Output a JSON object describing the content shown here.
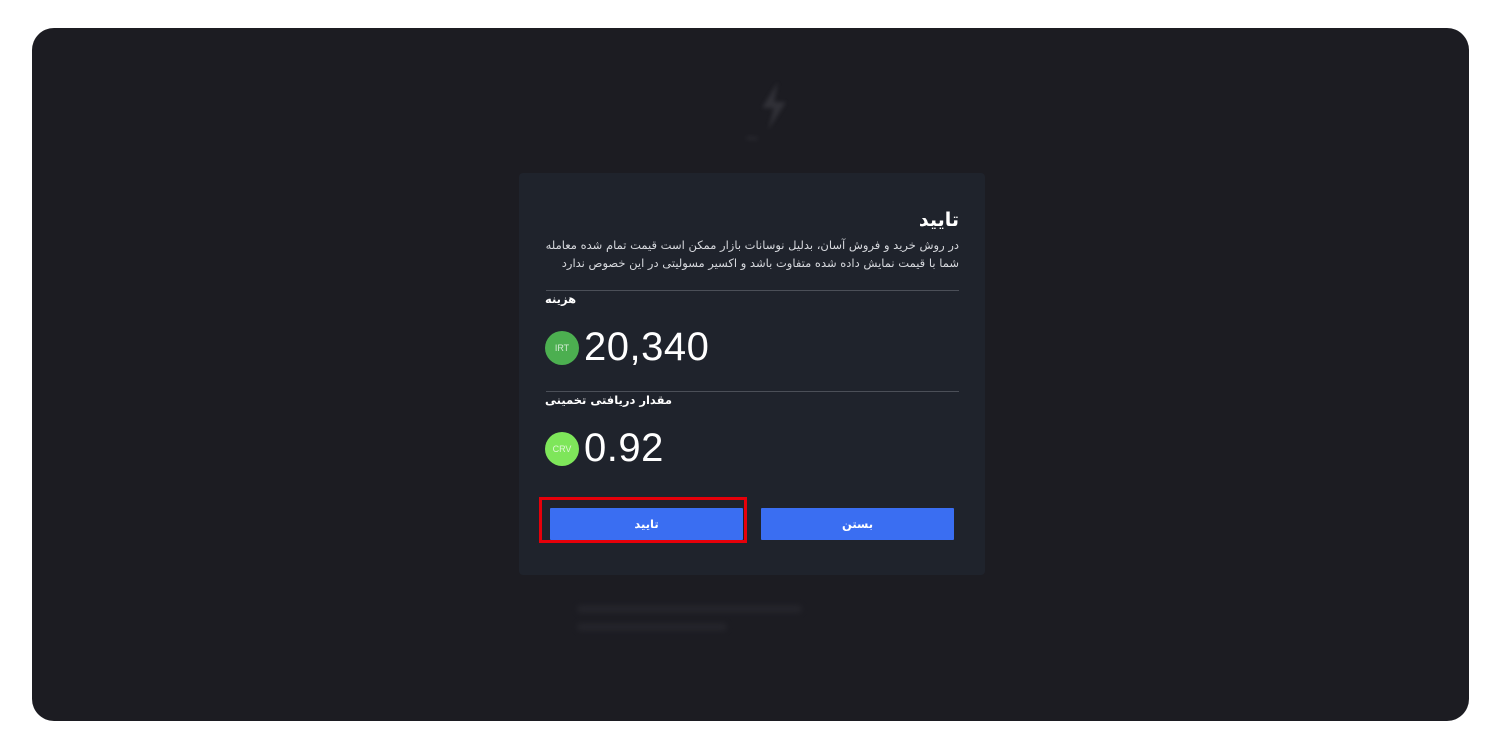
{
  "modal": {
    "title": "تایید",
    "description": "در روش خرید و فروش آسان، بدلیل نوسانات بازار ممکن است قیمت تمام شده معامله شما با قیمت نمایش داده شده متفاوت باشد و اکسیر مسولیتی در این خصوص ندارد",
    "cost": {
      "label": "هزینه",
      "amount": "20,340",
      "currency": "IRT",
      "coin_color": "#4caf50"
    },
    "estimated": {
      "label": "مقدار دریافتی تخمینی",
      "amount": "0.92",
      "currency": "CRV",
      "coin_color": "#7ee65a"
    },
    "buttons": {
      "confirm_label": "تایید",
      "close_label": "بستن"
    }
  },
  "colors": {
    "accent": "#3a6ef2",
    "highlight": "#e6000a",
    "modal_bg": "#1f232c",
    "page_bg": "#1c1c22"
  }
}
